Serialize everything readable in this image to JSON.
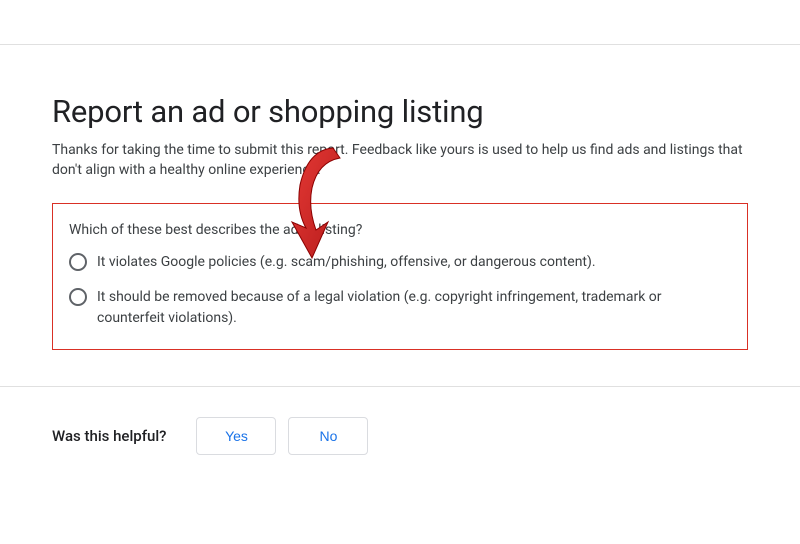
{
  "header": {
    "title": "Report an ad or shopping listing",
    "intro": "Thanks for taking the time to submit this report. Feedback like yours is used to help us find ads and listings that don't align with a healthy online experience."
  },
  "question": {
    "label": "Which of these best describes the ad or listing?",
    "options": [
      {
        "label": "It violates Google policies (e.g. scam/phishing, offensive, or dangerous content)."
      },
      {
        "label": "It should be removed because of a legal violation (e.g. copyright infringement, trademark or counterfeit violations)."
      }
    ]
  },
  "feedback": {
    "label": "Was this helpful?",
    "yes": "Yes",
    "no": "No"
  },
  "colors": {
    "error_border": "#d93025",
    "link_blue": "#1a73e8"
  }
}
